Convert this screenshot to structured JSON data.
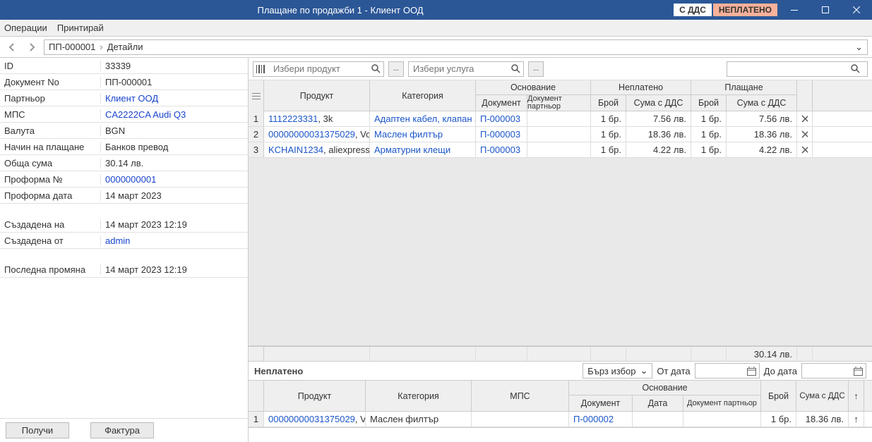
{
  "window": {
    "title": "Плащане по продажби 1 - Клиент ООД",
    "badge_vat": "С ДДС",
    "badge_unpaid": "НЕПЛАТЕНО"
  },
  "menu": {
    "ops": "Операции",
    "print": "Принтирай"
  },
  "breadcrumb": {
    "doc": "ПП-000001",
    "detail": "Детайли"
  },
  "props": {
    "id_k": "ID",
    "id_v": "33339",
    "docno_k": "Документ No",
    "docno_v": "ПП-000001",
    "partner_k": "Партньор",
    "partner_v": "Клиент ООД",
    "mps_k": "МПС",
    "mps_v": "CA2222CA Audi Q3",
    "currency_k": "Валута",
    "currency_v": "BGN",
    "paytype_k": "Начин на плащане",
    "paytype_v": "Банков превод",
    "total_k": "Обща сума",
    "total_v": "30.14 лв.",
    "proforma_k": "Проформа №",
    "proforma_v": "0000000001",
    "proformad_k": "Проформа дата",
    "proformad_v": "14 март 2023",
    "created_k": "Създадена на",
    "created_v": "14 март 2023 12:19",
    "createdby_k": "Създадена от",
    "createdby_v": "admin",
    "modified_k": "Последна промяна",
    "modified_v": "14 март 2023 12:19"
  },
  "buttons": {
    "receive": "Получи",
    "invoice": "Фактура"
  },
  "search": {
    "product_ph": "Избери продукт",
    "service_ph": "Избери услуга"
  },
  "grid_head": {
    "product": "Продукт",
    "category": "Категория",
    "basis": "Основание",
    "doc": "Документ",
    "docp": "Документ партньор",
    "unpaid": "Неплатено",
    "pay": "Плащане",
    "qty": "Брой",
    "sum": "Сума с ДДС"
  },
  "rows": [
    {
      "n": "1",
      "prod_link": "1112223331",
      "prod_rest": ", 3k",
      "cat": "Адаптен кабел, клапан з...",
      "doc": "П-000003",
      "docp": "",
      "qty": "1 бр.",
      "sum": "7.56 лв.",
      "qty2": "1 бр.",
      "sum2": "7.56 лв."
    },
    {
      "n": "2",
      "prod_link": "00000000031375029",
      "prod_rest": ", Vol...",
      "cat": "Маслен филтър",
      "doc": "П-000003",
      "docp": "",
      "qty": "1 бр.",
      "sum": "18.36 лв.",
      "qty2": "1 бр.",
      "sum2": "18.36 лв."
    },
    {
      "n": "3",
      "prod_link": "KCHAIN1234",
      "prod_rest": ", aliexpress",
      "cat": "Арматурни клещи",
      "doc": "П-000003",
      "docp": "",
      "qty": "1 бр.",
      "sum": "4.22 лв.",
      "qty2": "1 бр.",
      "sum2": "4.22 лв."
    }
  ],
  "grid_total": "30.14 лв.",
  "unpaid_section": {
    "title": "Неплатено",
    "quick": "Бърз избор",
    "from": "От дата",
    "to": "До дата"
  },
  "grid2_head": {
    "product": "Продукт",
    "category": "Категория",
    "mps": "МПС",
    "basis": "Основание",
    "doc": "Документ",
    "date": "Дата",
    "docp": "Документ партньор",
    "qty": "Брой",
    "sum": "Сума с ДДС"
  },
  "rows2": [
    {
      "n": "1",
      "prod_link": "00000000031375029",
      "prod_rest": ", Vol...",
      "cat": "Маслен филтър",
      "mps": "",
      "doc": "П-000002",
      "date": "",
      "docp": "",
      "qty": "1 бр.",
      "sum": "18.36 лв."
    }
  ]
}
